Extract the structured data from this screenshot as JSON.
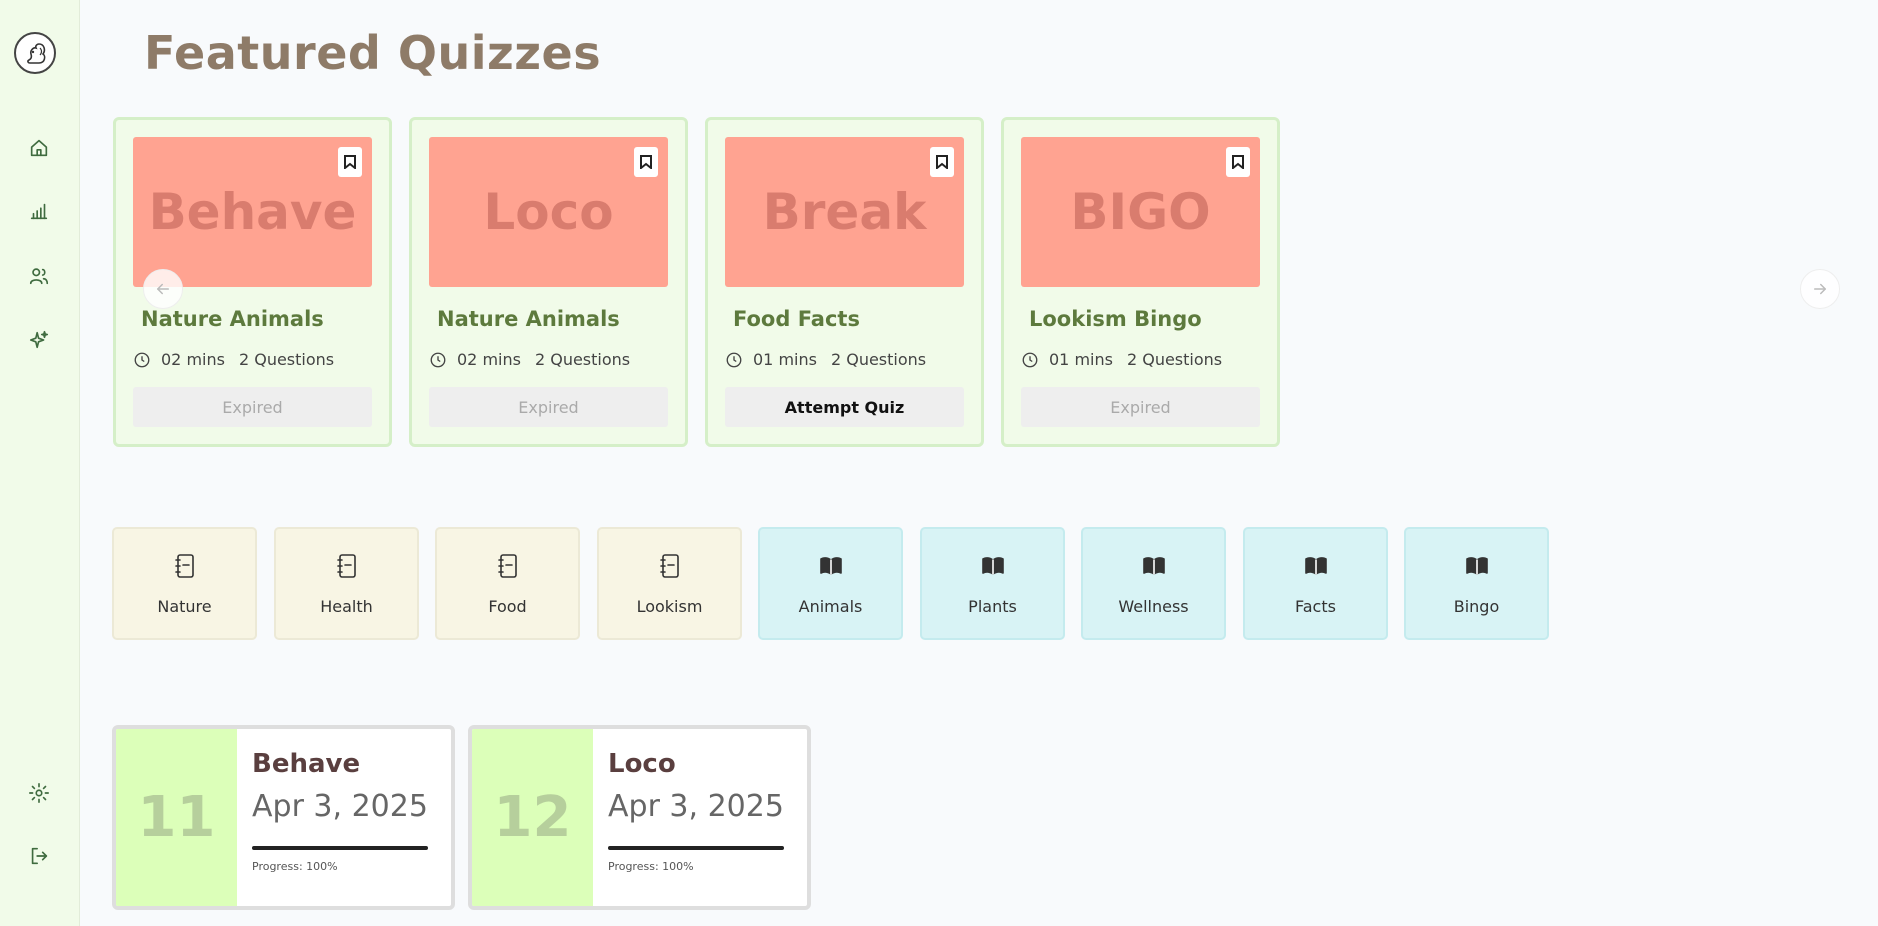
{
  "header": {
    "title": "Featured Quizzes"
  },
  "sidebar": {
    "items": [
      {
        "icon": "home-icon"
      },
      {
        "icon": "chart-icon"
      },
      {
        "icon": "users-icon"
      },
      {
        "icon": "sparkles-icon"
      }
    ],
    "bottom": [
      {
        "icon": "gear-icon"
      },
      {
        "icon": "logout-icon"
      }
    ]
  },
  "quizzes": [
    {
      "banner": "Behave",
      "name": "Nature Animals",
      "duration": "02 mins",
      "questions": "2 Questions",
      "action": "Expired",
      "active": false
    },
    {
      "banner": "Loco",
      "name": "Nature Animals",
      "duration": "02 mins",
      "questions": "2 Questions",
      "action": "Expired",
      "active": false
    },
    {
      "banner": "Break",
      "name": "Food Facts",
      "duration": "01 mins",
      "questions": "2 Questions",
      "action": "Attempt Quiz",
      "active": true
    },
    {
      "banner": "BIGO",
      "name": "Lookism Bingo",
      "duration": "01 mins",
      "questions": "2 Questions",
      "action": "Expired",
      "active": false
    }
  ],
  "topics": [
    "Nature",
    "Health",
    "Food",
    "Lookism"
  ],
  "tags": [
    "Animals",
    "Plants",
    "Wellness",
    "Facts",
    "Bingo"
  ],
  "progress_cards": [
    {
      "number": "11",
      "title": "Behave",
      "date": "Apr 3, 2025",
      "progress_label": "Progress: 100%",
      "progress": 100
    },
    {
      "number": "12",
      "title": "Loco",
      "date": "Apr 3, 2025",
      "progress_label": "Progress: 100%",
      "progress": 100
    }
  ],
  "colors": {
    "sidebar_bg": "#f1fbe9",
    "title": "#8e7b68",
    "banner": "#ffa391",
    "quiz_name": "#5d7a3d",
    "topic_bg": "#f8f5e4",
    "tag_bg": "#d8f3f5",
    "progress_num_bg": "#dcffb9"
  }
}
